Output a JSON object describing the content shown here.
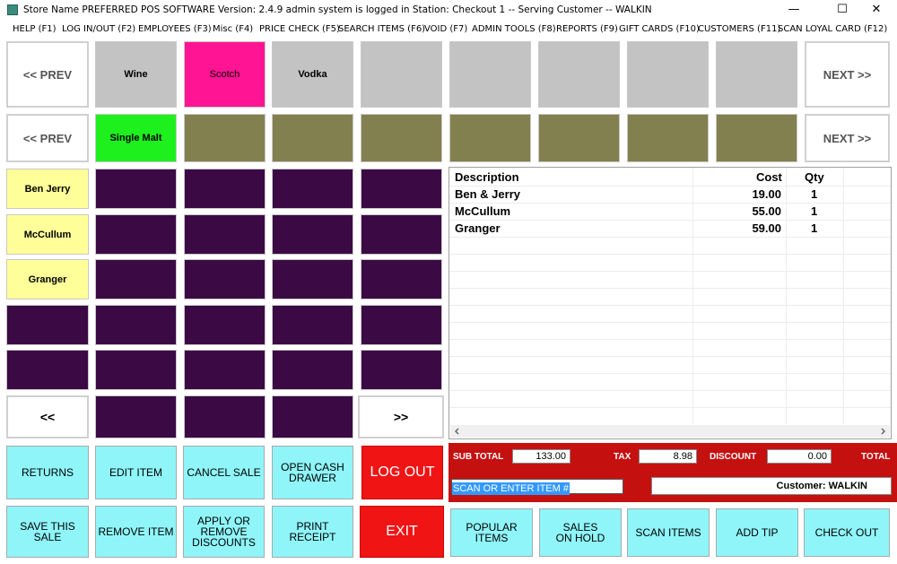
{
  "window": {
    "title": "Store Name  PREFERRED POS SOFTWARE Version: 2.4.9 admin system is logged in Station: Checkout 1 --  Serving Customer  --  WALKIN",
    "minimize": "—",
    "maximize": "☐",
    "close": "✕"
  },
  "menu": [
    "HELP (F1)",
    "LOG IN/OUT (F2)",
    "EMPLOYEES (F3)",
    "Misc (F4)",
    "PRICE CHECK (F5)",
    "SEARCH ITEMS (F6)",
    "VOID (F7)",
    "ADMIN TOOLS (F8)",
    "REPORTS (F9)",
    "GIFT CARDS (F10)",
    "CUSTOMERS (F11)",
    "SCAN LOYAL CARD (F12)"
  ],
  "category_row": {
    "prev": "<< PREV",
    "next": "NEXT >>",
    "items": [
      "Wine",
      "Scotch",
      "Vodka",
      "",
      "",
      "",
      "",
      ""
    ]
  },
  "subcategory_row": {
    "prev": "<< PREV",
    "next": "NEXT >>",
    "items": [
      "Single Malt",
      "",
      "",
      "",
      "",
      "",
      "",
      ""
    ]
  },
  "products": {
    "items": [
      "Ben  Jerry",
      "McCullum",
      "Granger"
    ],
    "prev": "<<",
    "next": ">>"
  },
  "order": {
    "headers": {
      "description": "Description",
      "cost": "Cost",
      "qty": "Qty"
    },
    "rows": [
      {
        "description": "Ben & Jerry",
        "cost": "19.00",
        "qty": "1"
      },
      {
        "description": "McCullum",
        "cost": "55.00",
        "qty": "1"
      },
      {
        "description": "Granger",
        "cost": "59.00",
        "qty": "1"
      }
    ]
  },
  "totals": {
    "subtotal_label": "SUB TOTAL",
    "subtotal": "133.00",
    "tax_label": "TAX",
    "tax": "8.98",
    "discount_label": "DISCOUNT",
    "discount": "0.00",
    "total_label": "TOTAL"
  },
  "scan": {
    "value": "SCAN OR ENTER ITEM #"
  },
  "customer": {
    "label": "Customer: WALKIN"
  },
  "actions": {
    "returns": "RETURNS",
    "edit_item": "EDIT ITEM",
    "cancel_sale": "CANCEL SALE",
    "open_cash_drawer": "OPEN CASH DRAWER",
    "log_out": "LOG OUT",
    "save_sale": "SAVE THIS SALE",
    "remove_item": "REMOVE ITEM",
    "discounts": "APPLY OR REMOVE DISCOUNTS",
    "print_receipt": "PRINT RECEIPT",
    "exit": "EXIT",
    "popular_items": "POPULAR ITEMS",
    "sales_on_hold": "SALES ON HOLD",
    "scan_items": "SCAN ITEMS",
    "add_tip": "ADD TIP",
    "check_out": "CHECK OUT"
  },
  "colors": {
    "magenta": "#ff1493",
    "green": "#1ef01e",
    "yellow": "#ffff99",
    "cyan": "#8ff5f8",
    "red": "#f01414",
    "olive": "#838050",
    "purple": "#3b0a45"
  }
}
